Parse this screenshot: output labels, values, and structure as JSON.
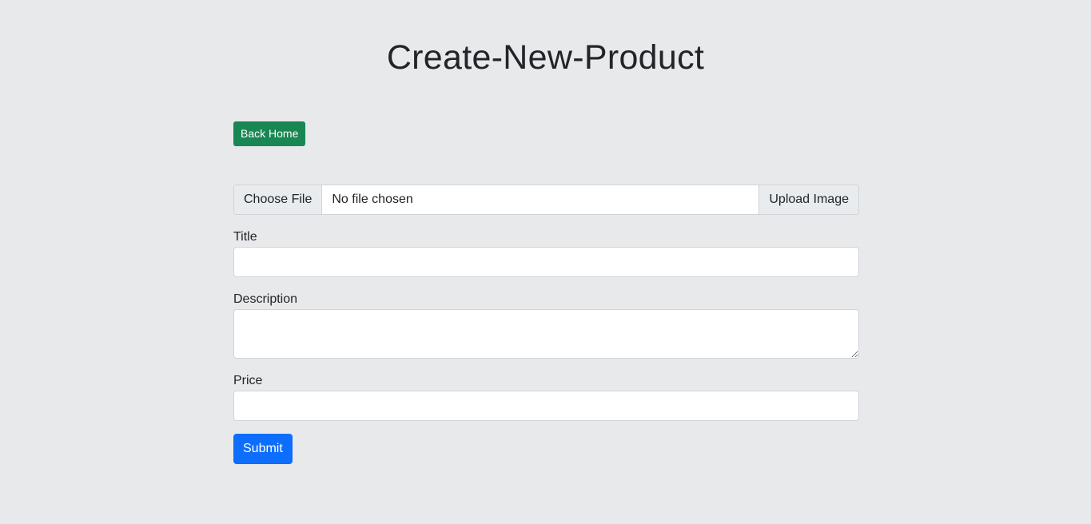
{
  "header": {
    "title": "Create-New-Product"
  },
  "nav": {
    "back_home_label": "Back Home"
  },
  "upload": {
    "choose_file_label": "Choose File",
    "file_status": "No file chosen",
    "upload_button_label": "Upload Image"
  },
  "form": {
    "title_label": "Title",
    "title_value": "",
    "description_label": "Description",
    "description_value": "",
    "price_label": "Price",
    "price_value": "",
    "submit_label": "Submit"
  },
  "colors": {
    "background": "#e8e9eb",
    "back_home_button": "#198754",
    "submit_button": "#0d6efd"
  }
}
